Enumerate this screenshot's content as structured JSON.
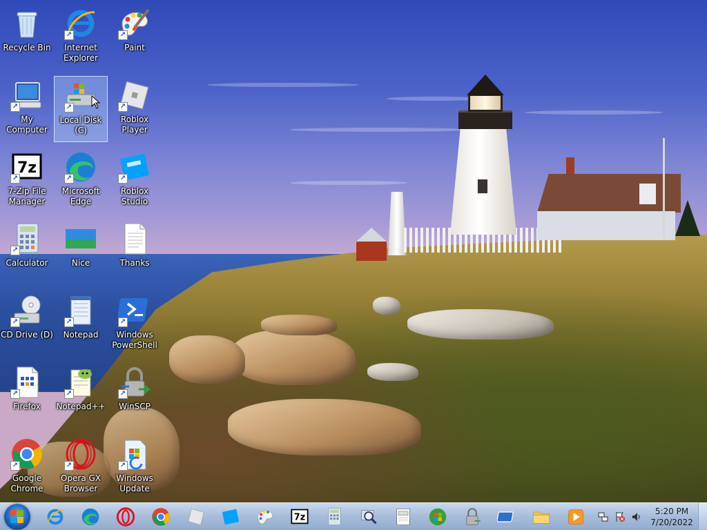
{
  "desktop": {
    "icons": [
      {
        "label": "Recycle Bin"
      },
      {
        "label": "Internet Explorer"
      },
      {
        "label": "Paint"
      },
      {
        "label": "My Computer"
      },
      {
        "label": "Local Disk (C)",
        "selected": true
      },
      {
        "label": "Roblox Player"
      },
      {
        "label": "7-Zip File Manager"
      },
      {
        "label": "Microsoft Edge"
      },
      {
        "label": "Roblox Studio"
      },
      {
        "label": "Calculator"
      },
      {
        "label": "Nice"
      },
      {
        "label": "Thanks"
      },
      {
        "label": "CD Drive (D)"
      },
      {
        "label": "Notepad"
      },
      {
        "label": "Windows PowerShell"
      },
      {
        "label": "Firefox"
      },
      {
        "label": "Notepad++"
      },
      {
        "label": "WinSCP"
      },
      {
        "label": "Google Chrome"
      },
      {
        "label": "Opera GX Browser"
      },
      {
        "label": "Windows Update"
      }
    ]
  },
  "taskbar": {
    "pinned": [
      "internet-explorer-icon",
      "edge-icon",
      "opera-icon",
      "chrome-icon",
      "roblox-player-icon",
      "roblox-studio-icon",
      "paint-icon",
      "7zip-icon",
      "calculator-icon",
      "magnifier-icon",
      "notepad-icon",
      "windows-logo-icon",
      "winscp-icon",
      "remote-desktop-icon",
      "file-explorer-icon",
      "media-player-icon"
    ],
    "clock": {
      "time": "5:20 PM",
      "date": "7/20/2022"
    }
  },
  "colors": {
    "taskbar": "#a6bcd9",
    "accent": "#1659b3"
  }
}
